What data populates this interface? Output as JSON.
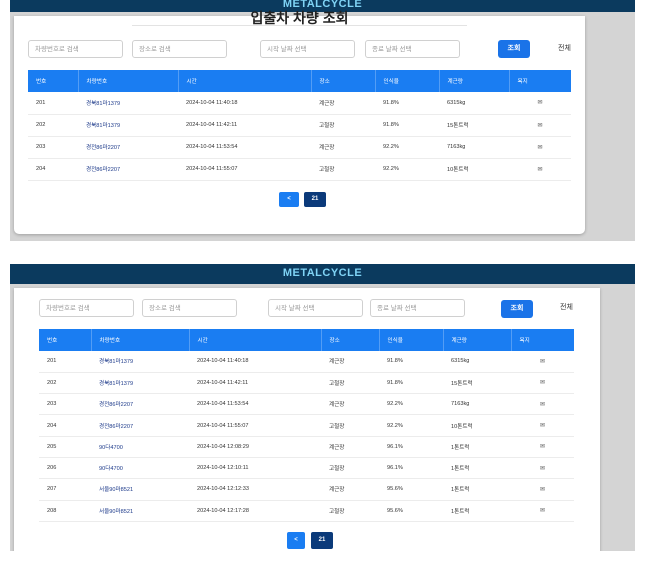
{
  "app": {
    "brand": "METALCYCLE",
    "title": "입출차 차량 조회"
  },
  "filters": {
    "vehicle_placeholder": "차량번호로 검색",
    "location_placeholder": "장소로 검색",
    "start_placeholder": "시작 날짜 선택",
    "end_placeholder": "종료 날짜 선택",
    "search_label": "조회",
    "all_label": "전체"
  },
  "table": {
    "headers": [
      "번호",
      "차량번호",
      "시간",
      "장소",
      "인식율",
      "계근량",
      "욕지"
    ],
    "rows": [
      {
        "no": "201",
        "plate": "경북81마1379",
        "time": "2024-10-04 11:40:18",
        "place": "계근장",
        "rate": "91.8%",
        "weight": "6315kg",
        "icon": "✉"
      },
      {
        "no": "202",
        "plate": "경북81마1379",
        "time": "2024-10-04 11:42:11",
        "place": "고철장",
        "rate": "91.8%",
        "weight": "15톤트럭",
        "icon": "✉"
      },
      {
        "no": "203",
        "plate": "경전86마2207",
        "time": "2024-10-04 11:53:54",
        "place": "계근장",
        "rate": "92.2%",
        "weight": "7163kg",
        "icon": "✉"
      },
      {
        "no": "204",
        "plate": "경전86마2207",
        "time": "2024-10-04 11:55:07",
        "place": "고철장",
        "rate": "92.2%",
        "weight": "10톤트럭",
        "icon": "✉"
      },
      {
        "no": "205",
        "plate": "90다4700",
        "time": "2024-10-04 12:08:29",
        "place": "계근장",
        "rate": "96.1%",
        "weight": "1톤트럭",
        "icon": "✉"
      },
      {
        "no": "206",
        "plate": "90다4700",
        "time": "2024-10-04 12:10:11",
        "place": "고철장",
        "rate": "96.1%",
        "weight": "1톤트럭",
        "icon": "✉"
      },
      {
        "no": "207",
        "plate": "서울90마8521",
        "time": "2024-10-04 12:12:33",
        "place": "계근장",
        "rate": "95.6%",
        "weight": "1톤트럭",
        "icon": "✉"
      },
      {
        "no": "208",
        "plate": "서울90마8521",
        "time": "2024-10-04 12:17:28",
        "place": "고철장",
        "rate": "95.6%",
        "weight": "1톤트럭",
        "icon": "✉"
      }
    ]
  },
  "pagination": {
    "prev_label": "<",
    "current_page": "21"
  }
}
